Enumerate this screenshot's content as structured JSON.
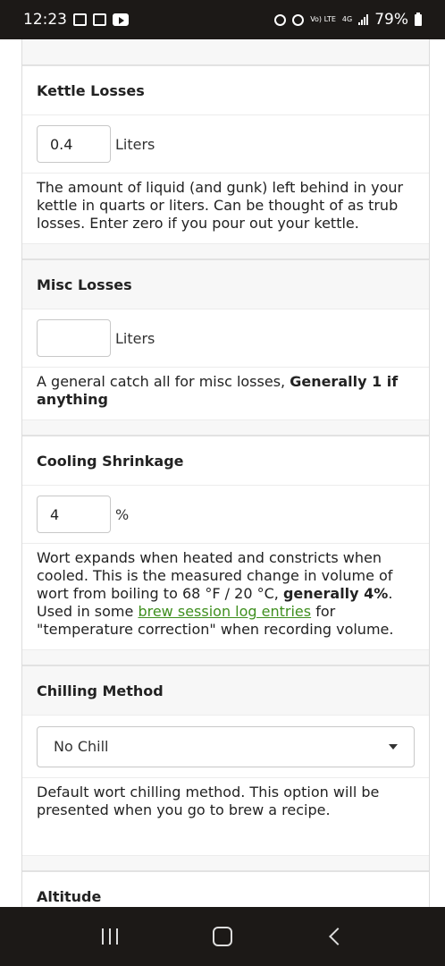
{
  "status_bar": {
    "time": "12:23",
    "network": "Vo) LTE",
    "network_type": "4G",
    "battery": "79%"
  },
  "sections": {
    "kettle_losses": {
      "title": "Kettle Losses",
      "value": "0.4",
      "unit": "Liters",
      "description": "The amount of liquid (and gunk) left behind in your kettle in quarts or liters. Can be thought of as trub losses. Enter zero if you pour out your kettle."
    },
    "misc_losses": {
      "title": "Misc Losses",
      "value": "",
      "unit": "Liters",
      "description_prefix": "A general catch all for misc losses, ",
      "description_bold": "Generally 1 if anything"
    },
    "cooling_shrinkage": {
      "title": "Cooling Shrinkage",
      "value": "4",
      "unit": "%",
      "desc_part1": "Wort expands when heated and constricts when cooled. This is the measured change in volume of wort from boiling to 68 °F / 20 °C, ",
      "desc_bold": "generally 4%",
      "desc_part2": ". Used in some ",
      "desc_link": "brew session log entries",
      "desc_part3": " for \"temperature correction\" when recording volume."
    },
    "chilling_method": {
      "title": "Chilling Method",
      "selected": "No Chill",
      "description": "Default wort chilling method. This option will be presented when you go to brew a recipe."
    },
    "altitude": {
      "title": "Altitude"
    }
  },
  "nav_bar": {
    "recents_icon": "recents-icon",
    "home_icon": "home-icon",
    "back_icon": "back-icon"
  }
}
